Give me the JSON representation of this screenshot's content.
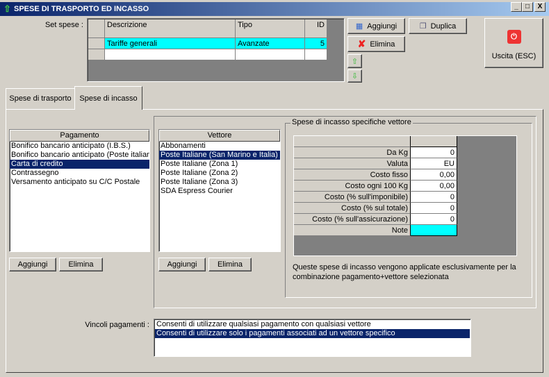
{
  "window": {
    "title": "SPESE DI TRASPORTO ED INCASSO",
    "controls": [
      "_",
      "□",
      "X"
    ]
  },
  "set_spese": {
    "label": "Set spese :",
    "columns": [
      "Descrizione",
      "Tipo",
      "ID"
    ],
    "rows": [
      {
        "descrizione": "Tariffe generali",
        "tipo": "Avanzate",
        "id": "5"
      }
    ]
  },
  "toolbar": {
    "aggiungi": "Aggiungi",
    "duplica": "Duplica",
    "elimina": "Elimina",
    "uscita": "Uscita (ESC)"
  },
  "tabs": [
    {
      "label": "Spese di trasporto",
      "active": false
    },
    {
      "label": "Spese di incasso",
      "active": true
    }
  ],
  "pagamento": {
    "header": "Pagamento",
    "items": [
      "Bonifico bancario anticipato (I.B.S.)",
      "Bonifico bancario anticipato (Poste italiane)",
      "Carta di credito",
      "Contrassegno",
      "Versamento anticipato su C/C Postale"
    ],
    "selected": 2,
    "add": "Aggiungi",
    "remove": "Elimina"
  },
  "vettore": {
    "header": "Vettore",
    "items": [
      "Abbonamenti",
      "Poste Italiane (San Marino e Italia)",
      "Poste Italiane (Zona 1)",
      "Poste Italiane (Zona 2)",
      "Poste Italiane (Zona 3)",
      "SDA Espress Courier"
    ],
    "selected": 1,
    "add": "Aggiungi",
    "remove": "Elimina"
  },
  "specifiche": {
    "title": "Spese di incasso specifiche vettore",
    "rows": [
      {
        "label": "Da Kg",
        "value": "0"
      },
      {
        "label": "Valuta",
        "value": "EU"
      },
      {
        "label": "Costo fisso",
        "value": "0,00"
      },
      {
        "label": "Costo ogni 100 Kg",
        "value": "0,00"
      },
      {
        "label": "Costo (% sull'imponibile)",
        "value": "0"
      },
      {
        "label": "Costo (% sul totale)",
        "value": "0"
      },
      {
        "label": "Costo (% sull'assicurazione)",
        "value": "0"
      },
      {
        "label": "Note",
        "value": ""
      }
    ],
    "note": "Queste spese di incasso vengono applicate esclusivamente per la combinazione pagamento+vettore selezionata"
  },
  "vincoli": {
    "label": "Vincoli pagamenti :",
    "options": [
      "Consenti di utilizzare qualsiasi pagamento con qualsiasi vettore",
      "Consenti di utilizzare solo i pagamenti associati ad un vettore specifico"
    ],
    "selected": 1
  },
  "colors": {
    "selection": "#0a246a",
    "cyan": "#00ffff",
    "title": "#0a246a"
  }
}
